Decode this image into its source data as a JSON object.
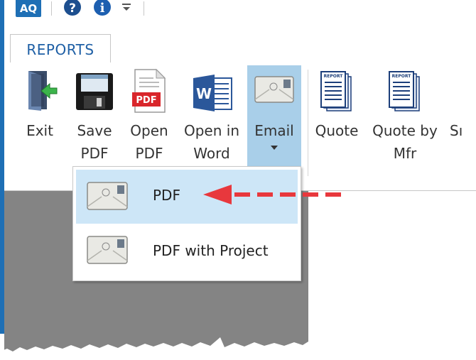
{
  "quick_access": {
    "app_logo_text": "AQ",
    "help_icon": "question-icon",
    "info_icon": "info-icon",
    "customize_icon": "customize-dropdown-icon"
  },
  "tabs": [
    {
      "label": "REPORTS",
      "active": true
    }
  ],
  "ribbon": {
    "buttons": [
      {
        "line1": "Exit",
        "line2": "",
        "icon": "exit-door-icon"
      },
      {
        "line1": "Save",
        "line2": "PDF",
        "icon": "floppy-disk-icon"
      },
      {
        "line1": "Open",
        "line2": "PDF",
        "icon": "pdf-file-icon"
      },
      {
        "line1": "Open in",
        "line2": "Word",
        "icon": "word-doc-icon"
      },
      {
        "line1": "Email",
        "line2": "",
        "icon": "envelope-icon",
        "dropdown": true,
        "pressed": true
      },
      {
        "line1": "Quote",
        "line2": "",
        "icon": "report-icon"
      },
      {
        "line1": "Quote by",
        "line2": "Mfr",
        "icon": "report-icon"
      },
      {
        "line1": "Sı",
        "line2": "",
        "icon": ""
      }
    ]
  },
  "email_menu": {
    "items": [
      {
        "label": "PDF",
        "icon": "envelope-icon",
        "highlighted": true
      },
      {
        "label": "PDF with Project",
        "icon": "envelope-icon",
        "highlighted": false
      }
    ]
  },
  "colors": {
    "accent_blue": "#1e6fb5",
    "tab_text": "#1e5fa5",
    "pressed_button": "#a9cfe9",
    "menu_highlight": "#cde6f7",
    "arrow_red": "#e8383d",
    "app_gray": "#848484"
  }
}
